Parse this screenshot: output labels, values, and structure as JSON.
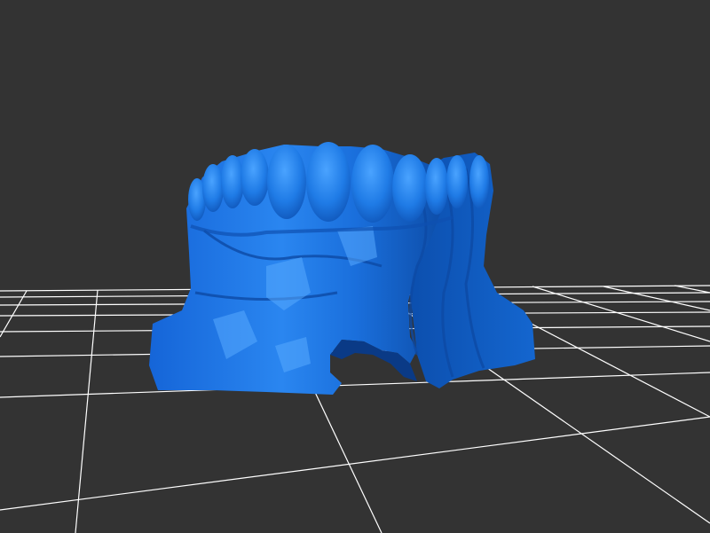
{
  "viewer": {
    "background_color": "#333333",
    "grid_color": "#ffffff",
    "model_color": "#1a73e0",
    "model_highlight_color": "#4aa3ff",
    "model_shadow_color": "#0b3f8c",
    "model_kind": "dental arch scan (lower jaw)",
    "grid_visible": true
  }
}
